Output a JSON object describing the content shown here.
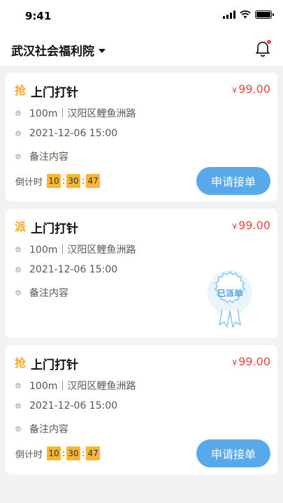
{
  "status": {
    "time": "9:41"
  },
  "header": {
    "org_name": "武汉社会福利院"
  },
  "colors": {
    "accent": "#57a9ec",
    "price": "#e94440",
    "highlight": "#f7b733"
  },
  "cards": [
    {
      "type_icon": "抢",
      "type_icon_name": "grab-order-icon",
      "title": "上门打针",
      "currency": "¥",
      "price": "99.00",
      "location": "100m｜汉阳区鲤鱼洲路",
      "time": "2021-12-06 15:00",
      "note": "备注内容",
      "countdown_label": "倒计时",
      "countdown": [
        "10",
        "30",
        "47"
      ],
      "button": "申请接单"
    },
    {
      "type_icon": "派",
      "type_icon_name": "dispatch-order-icon",
      "title": "上门打针",
      "currency": "¥",
      "price": "99.00",
      "location": "100m｜汉阳区鲤鱼洲路",
      "time": "2021-12-06 15:00",
      "note": "备注内容",
      "stamp": "已派单"
    },
    {
      "type_icon": "抢",
      "type_icon_name": "grab-order-icon",
      "title": "上门打针",
      "currency": "¥",
      "price": "99.00",
      "location": "100m｜汉阳区鲤鱼洲路",
      "time": "2021-12-06 15:00",
      "note": "备注内容",
      "countdown_label": "倒计时",
      "countdown": [
        "10",
        "30",
        "47"
      ],
      "button": "申请接单"
    }
  ]
}
